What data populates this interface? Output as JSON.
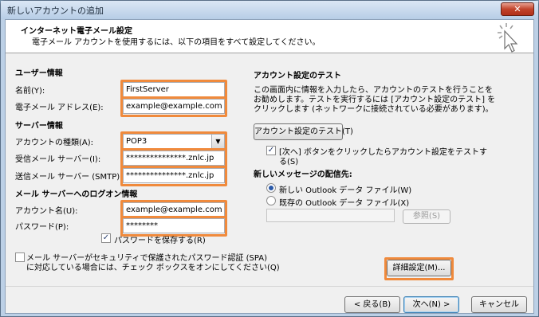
{
  "window": {
    "title": "新しいアカウントの追加",
    "close_label": "✕"
  },
  "header": {
    "title": "インターネット電子メール設定",
    "subtitle": "電子メール アカウントを使用するには、以下の項目をすべて設定してください。"
  },
  "user_info": {
    "section": "ユーザー情報",
    "name_label": "名前(Y):",
    "name_value": "FirstServer",
    "email_label": "電子メール アドレス(E):",
    "email_value": "example@example.com"
  },
  "server_info": {
    "section": "サーバー情報",
    "account_type_label": "アカウントの種類(A):",
    "account_type_value": "POP3",
    "incoming_label": "受信メール サーバー(I):",
    "incoming_value": "***************.znlc.jp",
    "outgoing_label": "送信メール サーバー (SMTP)(O):",
    "outgoing_value": "***************.znlc.jp"
  },
  "logon_info": {
    "section": "メール サーバーへのログオン情報",
    "account_name_label": "アカウント名(U):",
    "account_name_value": "example@example.com",
    "password_label": "パスワード(P):",
    "password_value": "********",
    "remember_label": "パスワードを保存する(R)",
    "remember_checked": true,
    "spa_label_line1": "メール サーバーがセキュリティで保護されたパスワード認証 (SPA)",
    "spa_label_line2": "に対応している場合には、チェック ボックスをオンにしてください(Q)",
    "spa_checked": false
  },
  "test": {
    "section": "アカウント設定のテスト",
    "description_line1": "この画面内に情報を入力したら、アカウントのテストを行うことを",
    "description_line2": "お勧めします。テストを実行するには [アカウント設定のテスト] を",
    "description_line3": "クリックします (ネットワークに接続されている必要があります)。",
    "test_button": "アカウント設定のテスト(T)",
    "auto_test_label_line1": "[次へ] ボタンをクリックしたらアカウント設定をテストす",
    "auto_test_label_line2": "る(S)",
    "auto_test_checked": true
  },
  "delivery": {
    "section": "新しいメッセージの配信先:",
    "new_file_label": "新しい Outlook データ ファイル(W)",
    "existing_file_label": "既存の Outlook データ ファイル(X)",
    "selected": "new",
    "path_value": "",
    "browse_button": "参照(S)"
  },
  "more_settings_button": "詳細設定(M)...",
  "footer": {
    "back_button": "< 戻る(B)",
    "next_button": "次へ(N) >",
    "cancel_button": "キャンセル"
  },
  "colors": {
    "highlight": "#f08a3c",
    "title_bar": "#bcd0e6"
  }
}
